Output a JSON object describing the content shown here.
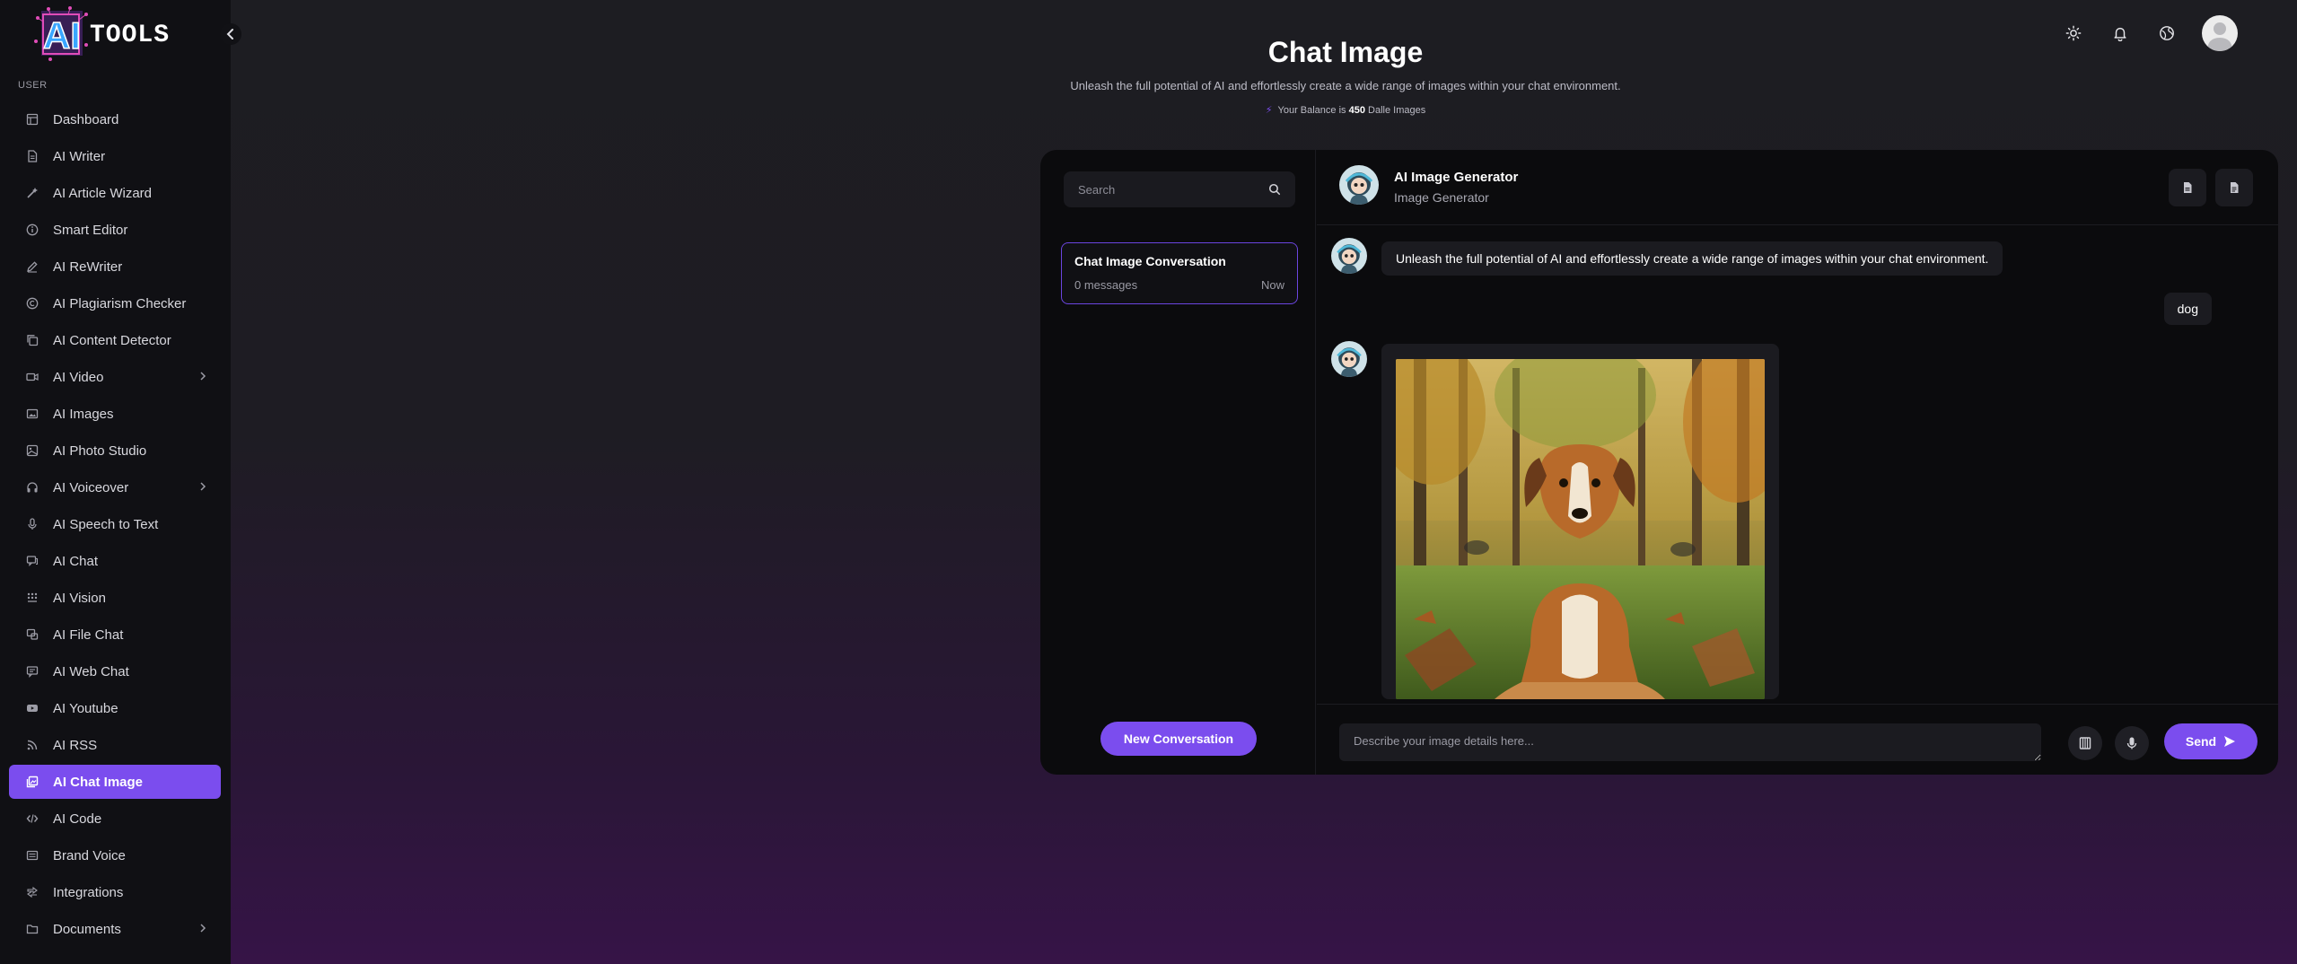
{
  "app": {
    "logo_text": "AI TOOLS",
    "colors": {
      "accent": "#7b4dee",
      "sidebar_bg": "#101014",
      "card_bg": "#0b0b0d"
    }
  },
  "sidebar": {
    "section_label": "USER",
    "items": [
      {
        "label": "Dashboard",
        "icon": "dashboard-icon",
        "chevron": false,
        "active": false
      },
      {
        "label": "AI Writer",
        "icon": "document-icon",
        "chevron": false,
        "active": false
      },
      {
        "label": "AI Article Wizard",
        "icon": "wand-icon",
        "chevron": false,
        "active": false
      },
      {
        "label": "Smart Editor",
        "icon": "info-icon",
        "chevron": false,
        "active": false
      },
      {
        "label": "AI ReWriter",
        "icon": "pencil-icon",
        "chevron": false,
        "active": false
      },
      {
        "label": "AI Plagiarism Checker",
        "icon": "copyright-icon",
        "chevron": false,
        "active": false
      },
      {
        "label": "AI Content Detector",
        "icon": "copy-icon",
        "chevron": false,
        "active": false
      },
      {
        "label": "AI Video",
        "icon": "video-icon",
        "chevron": true,
        "active": false
      },
      {
        "label": "AI Images",
        "icon": "image-icon",
        "chevron": false,
        "active": false
      },
      {
        "label": "AI Photo Studio",
        "icon": "photo-icon",
        "chevron": false,
        "active": false
      },
      {
        "label": "AI Voiceover",
        "icon": "headphones-icon",
        "chevron": true,
        "active": false
      },
      {
        "label": "AI Speech to Text",
        "icon": "microphone-icon",
        "chevron": false,
        "active": false
      },
      {
        "label": "AI Chat",
        "icon": "chat-icon",
        "chevron": false,
        "active": false
      },
      {
        "label": "AI Vision",
        "icon": "grid-icon",
        "chevron": false,
        "active": false
      },
      {
        "label": "AI File Chat",
        "icon": "file-chat-icon",
        "chevron": false,
        "active": false
      },
      {
        "label": "AI Web Chat",
        "icon": "web-chat-icon",
        "chevron": false,
        "active": false
      },
      {
        "label": "AI Youtube",
        "icon": "youtube-icon",
        "chevron": false,
        "active": false
      },
      {
        "label": "AI RSS",
        "icon": "rss-icon",
        "chevron": false,
        "active": false
      },
      {
        "label": "AI Chat Image",
        "icon": "chat-image-icon",
        "chevron": false,
        "active": true
      },
      {
        "label": "AI Code",
        "icon": "code-icon",
        "chevron": false,
        "active": false
      },
      {
        "label": "Brand Voice",
        "icon": "brand-icon",
        "chevron": false,
        "active": false
      },
      {
        "label": "Integrations",
        "icon": "integrations-icon",
        "chevron": false,
        "active": false
      },
      {
        "label": "Documents",
        "icon": "folder-icon",
        "chevron": true,
        "active": false
      }
    ]
  },
  "header": {
    "title": "Chat Image",
    "subtitle": "Unleash the full potential of AI and effortlessly create a wide range of images within your chat environment.",
    "balance_prefix": "Your Balance is",
    "balance_value": "450",
    "balance_suffix": "Dalle Images"
  },
  "conversations": {
    "search_placeholder": "Search",
    "items": [
      {
        "title": "Chat Image Conversation",
        "count": "0 messages",
        "time": "Now"
      }
    ],
    "new_button": "New Conversation"
  },
  "chat": {
    "bot_name": "AI Image Generator",
    "bot_role": "Image Generator",
    "messages": {
      "bot_intro": "Unleash the full potential of AI and effortlessly create a wide range of images within your chat environment.",
      "user_prompt": "dog"
    },
    "input_placeholder": "Describe your image details here...",
    "send_label": "Send"
  }
}
